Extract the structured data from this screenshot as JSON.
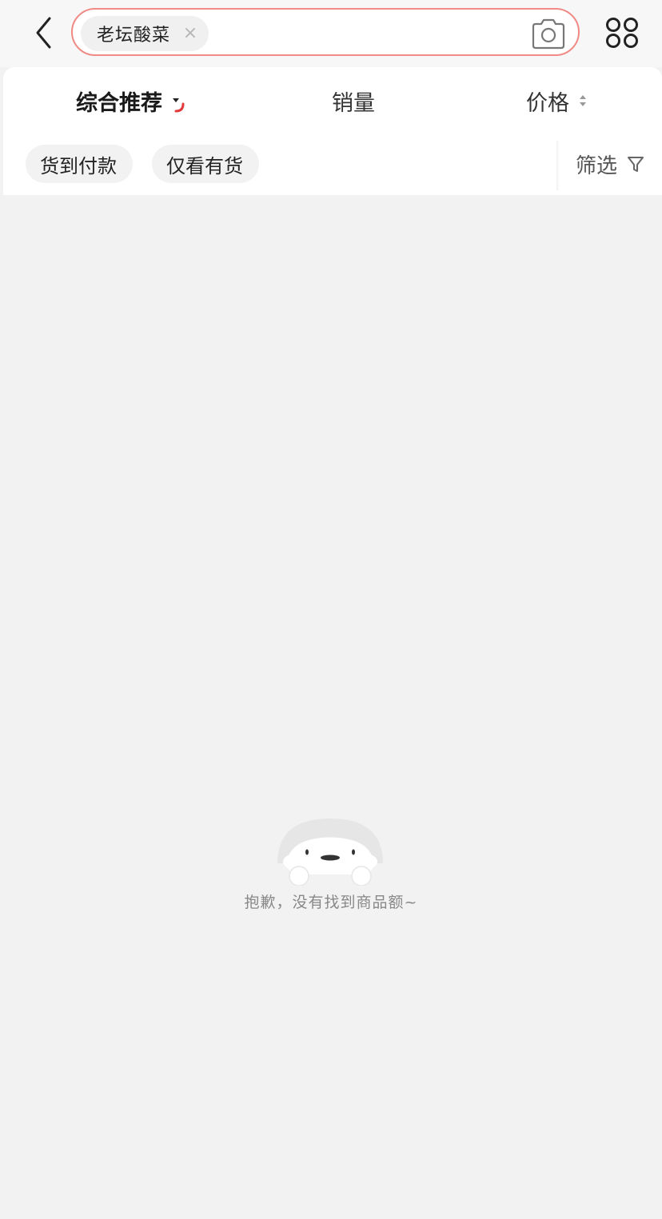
{
  "search": {
    "query": "老坛酸菜",
    "clear_symbol": "×"
  },
  "icons": {
    "back": "chevron-left-icon",
    "camera": "camera-icon",
    "more": "grid-circles-icon",
    "sort_dropdown": "caret-down-icon",
    "price_sort": "sort-up-down-icon",
    "filter": "funnel-icon"
  },
  "sort_tabs": [
    {
      "label": "综合推荐",
      "active": true
    },
    {
      "label": "销量",
      "active": false
    },
    {
      "label": "价格",
      "active": false
    }
  ],
  "filter_chips": [
    {
      "label": "货到付款"
    },
    {
      "label": "仅看有货"
    }
  ],
  "filter_button": {
    "label": "筛选"
  },
  "empty_state": {
    "message": "抱歉，没有找到商品额~"
  },
  "colors": {
    "search_border": "#f08a86",
    "accent_red": "#e4393c",
    "page_bg": "#f2f2f2"
  }
}
